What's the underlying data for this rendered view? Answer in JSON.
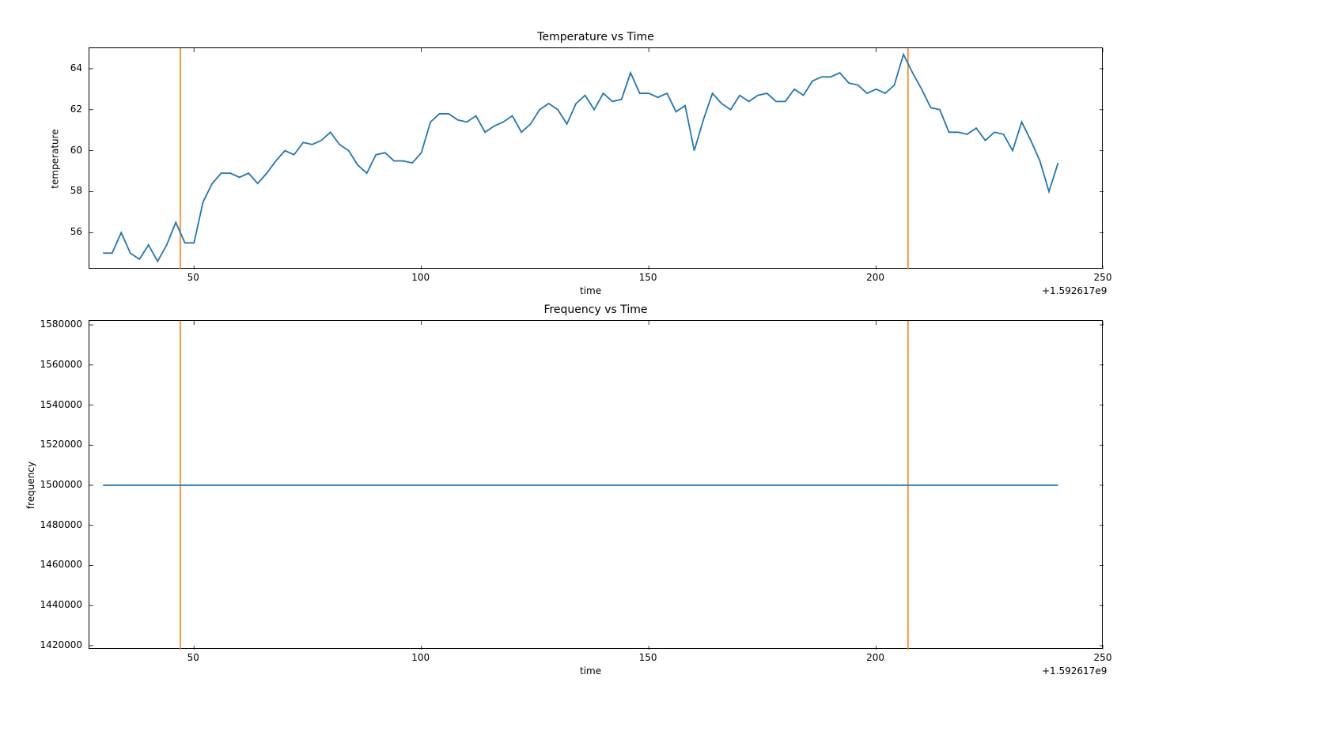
{
  "chart_data": [
    {
      "type": "line",
      "title": "Temperature vs Time",
      "xlabel": "time",
      "ylabel": "temperature",
      "x_offset_text": "+1.592617e9",
      "xlim": [
        27,
        250
      ],
      "ylim": [
        54.2,
        65.0
      ],
      "xticks": [
        50,
        100,
        150,
        200,
        250
      ],
      "yticks": [
        56,
        58,
        60,
        62,
        64
      ],
      "vlines_x": [
        47,
        207
      ],
      "x": [
        30,
        32,
        34,
        36,
        38,
        40,
        42,
        44,
        46,
        48,
        50,
        52,
        54,
        56,
        58,
        60,
        62,
        64,
        66,
        68,
        70,
        72,
        74,
        76,
        78,
        80,
        82,
        84,
        86,
        88,
        90,
        92,
        94,
        96,
        98,
        100,
        102,
        104,
        106,
        108,
        110,
        112,
        114,
        116,
        118,
        120,
        122,
        124,
        126,
        128,
        130,
        132,
        134,
        136,
        138,
        140,
        142,
        144,
        146,
        148,
        150,
        152,
        154,
        156,
        158,
        160,
        162,
        164,
        166,
        168,
        170,
        172,
        174,
        176,
        178,
        180,
        182,
        184,
        186,
        188,
        190,
        192,
        194,
        196,
        198,
        200,
        202,
        204,
        206,
        208,
        210,
        212,
        214,
        216,
        218,
        220,
        222,
        224,
        226,
        228,
        230,
        232,
        234,
        236,
        238,
        240
      ],
      "values": [
        55.0,
        55.0,
        56.0,
        55.0,
        54.7,
        55.4,
        54.6,
        55.4,
        56.5,
        55.5,
        55.5,
        57.5,
        58.4,
        58.9,
        58.9,
        58.7,
        58.9,
        58.4,
        58.9,
        59.5,
        60.0,
        59.8,
        60.4,
        60.3,
        60.5,
        60.9,
        60.3,
        60.0,
        59.3,
        58.9,
        59.8,
        59.9,
        59.5,
        59.5,
        59.4,
        59.9,
        61.4,
        61.8,
        61.8,
        61.5,
        61.4,
        61.7,
        60.9,
        61.2,
        61.4,
        61.7,
        60.9,
        61.3,
        62.0,
        62.3,
        62.0,
        61.3,
        62.3,
        62.7,
        62.0,
        62.8,
        62.4,
        62.5,
        63.8,
        62.8,
        62.8,
        62.6,
        62.8,
        61.9,
        62.2,
        60.0,
        61.5,
        62.8,
        62.3,
        62.0,
        62.7,
        62.4,
        62.7,
        62.8,
        62.4,
        62.4,
        63.0,
        62.7,
        63.4,
        63.6,
        63.6,
        63.8,
        63.3,
        63.2,
        62.8,
        63.0,
        62.8,
        63.2,
        64.7,
        63.8,
        63.0,
        62.1,
        62.0,
        60.9,
        60.9,
        60.8,
        61.1,
        60.5,
        60.9,
        60.8,
        60.0,
        61.4,
        60.5,
        59.5,
        58.0,
        59.4
      ],
      "color": "#1f77b4",
      "vline_color": "#ff7f0e"
    },
    {
      "type": "line",
      "title": "Frequency vs Time",
      "xlabel": "time",
      "ylabel": "frequency",
      "x_offset_text": "+1.592617e9",
      "xlim": [
        27,
        250
      ],
      "ylim": [
        1418000,
        1582000
      ],
      "xticks": [
        50,
        100,
        150,
        200,
        250
      ],
      "yticks": [
        1420000,
        1440000,
        1460000,
        1480000,
        1500000,
        1520000,
        1540000,
        1560000,
        1580000
      ],
      "vlines_x": [
        47,
        207
      ],
      "x": [
        30,
        240
      ],
      "values": [
        1500000,
        1500000
      ],
      "color": "#1f77b4",
      "vline_color": "#ff7f0e"
    }
  ]
}
